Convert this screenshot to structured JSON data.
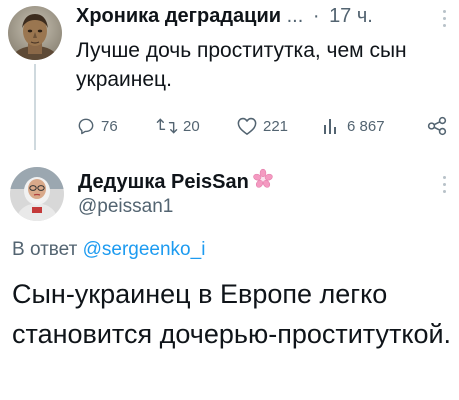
{
  "tweet1": {
    "author_name": "Хроника деградации",
    "name_ellipsis": "...",
    "separator": "·",
    "time": "17 ч.",
    "text": "Лучше дочь проститутка, чем сын украинец.",
    "replies": "76",
    "retweets": "20",
    "likes": "221",
    "views": "6 867",
    "icons": [
      "reply-icon",
      "retweet-icon",
      "like-icon",
      "views-icon",
      "share-icon",
      "more-icon"
    ]
  },
  "tweet2": {
    "author_name": "Дедушка PeisSan",
    "name_emoji_icon": "sakura-icon",
    "handle": "@peissan1",
    "reply_prefix": "В ответ",
    "reply_to": "@sergeenko_i",
    "text": "Сын-украинец в Европе легко становится дочерью-проституткой."
  },
  "colors": {
    "text_primary": "#0f1419",
    "text_secondary": "#536471",
    "link": "#1d9bf0",
    "thread_line": "#cfd9de",
    "sakura": "#f49ac1"
  }
}
